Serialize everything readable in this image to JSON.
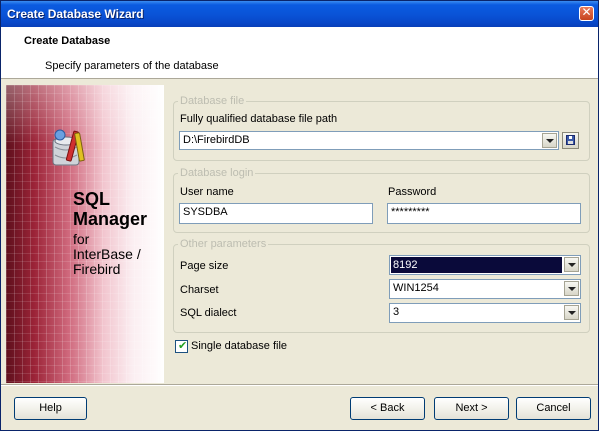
{
  "window": {
    "title": "Create Database Wizard"
  },
  "header": {
    "title": "Create Database",
    "subtitle": "Specify parameters of the database"
  },
  "banner": {
    "product_line1": "SQL",
    "product_line2": "Manager",
    "for_line1": "for",
    "for_line2": "InterBase /",
    "for_line3": "Firebird"
  },
  "database_file": {
    "legend": "Database file",
    "path_label": "Fully qualified database file path",
    "path_value": "D:\\FirebirdDB"
  },
  "database_login": {
    "legend": "Database login",
    "user_label": "User name",
    "user_value": "SYSDBA",
    "password_label": "Password",
    "password_value": "*********"
  },
  "other_parameters": {
    "legend": "Other parameters",
    "page_size_label": "Page size",
    "page_size_value": "8192",
    "charset_label": "Charset",
    "charset_value": "WIN1254",
    "dialect_label": "SQL dialect",
    "dialect_value": "3"
  },
  "single_file": {
    "label": "Single database file",
    "checked": true
  },
  "buttons": {
    "help": "Help",
    "back": "< Back",
    "next": "Next >",
    "cancel": "Cancel"
  }
}
